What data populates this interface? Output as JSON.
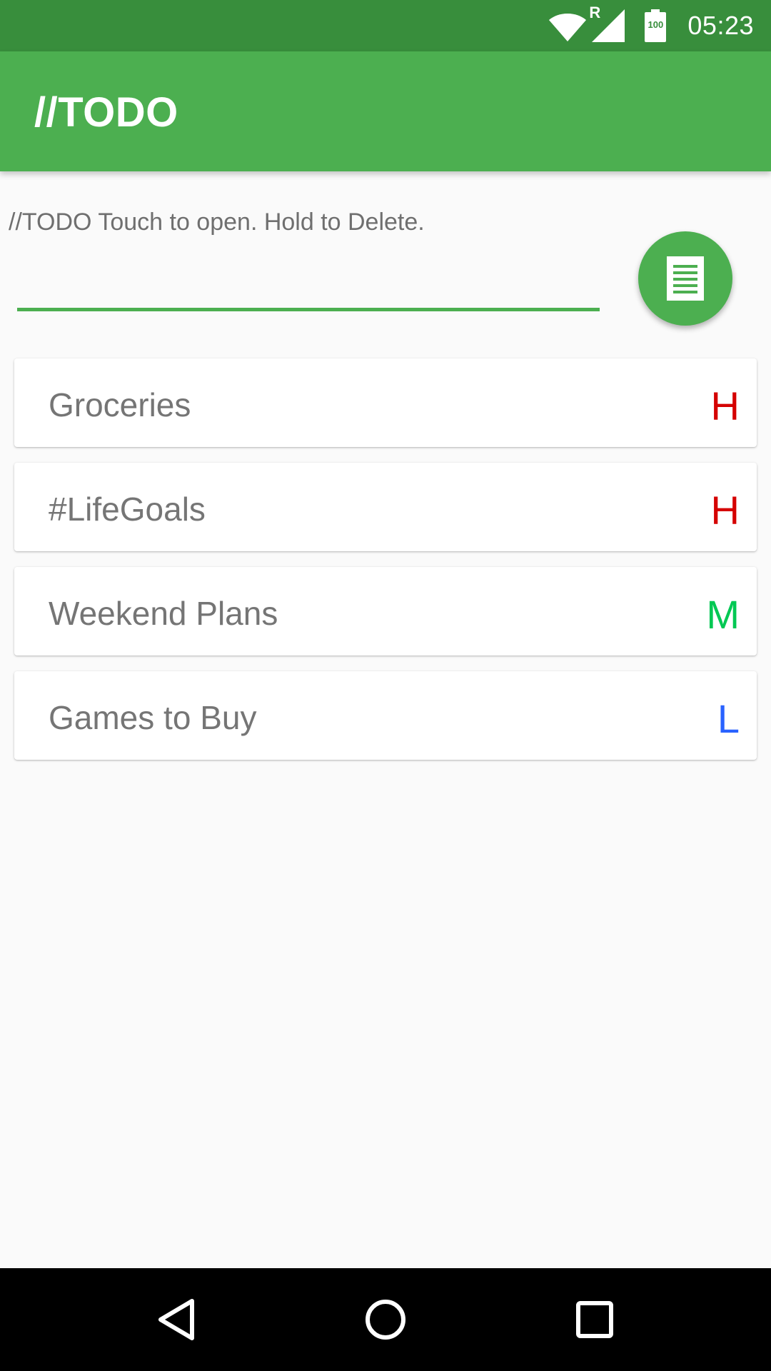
{
  "status_bar": {
    "network_badge": "R",
    "battery_level": "100",
    "time": "05:23"
  },
  "app_bar": {
    "title": "//TODO"
  },
  "main": {
    "hint": "//TODO Touch to open. Hold to Delete.",
    "input": {
      "value": "",
      "placeholder": ""
    },
    "fab_icon": "list-document-icon"
  },
  "lists": [
    {
      "title": "Groceries",
      "priority": "H",
      "priority_color": "#d50000"
    },
    {
      "title": "#LifeGoals",
      "priority": "H",
      "priority_color": "#d50000"
    },
    {
      "title": "Weekend Plans",
      "priority": "M",
      "priority_color": "#00c853"
    },
    {
      "title": "Games to Buy",
      "priority": "L",
      "priority_color": "#2962ff"
    }
  ],
  "nav_bar": {
    "icons": [
      "back-icon",
      "home-icon",
      "recents-icon"
    ]
  },
  "colors": {
    "primary": "#4caf50",
    "primary_dark": "#388e3c",
    "background": "#fafafa"
  }
}
